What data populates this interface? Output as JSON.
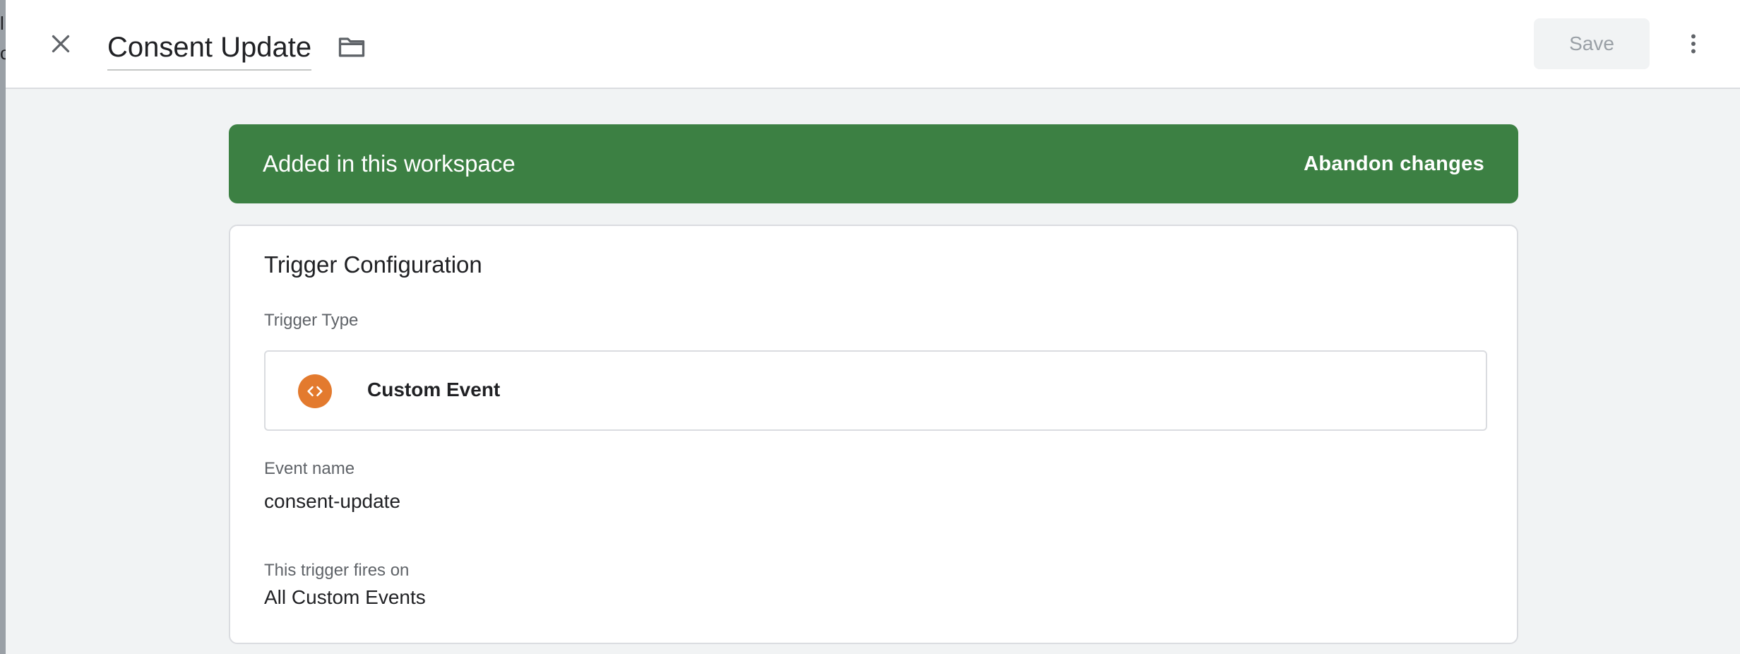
{
  "header": {
    "title": "Consent Update",
    "save_label": "Save"
  },
  "banner": {
    "text": "Added in this workspace",
    "action": "Abandon changes"
  },
  "card": {
    "title": "Trigger Configuration",
    "trigger_type_label": "Trigger Type",
    "trigger_type_value": "Custom Event",
    "event_name_label": "Event name",
    "event_name_value": "consent-update",
    "fires_on_label": "This trigger fires on",
    "fires_on_value": "All Custom Events"
  },
  "icons": {
    "close": "close-icon",
    "folder": "folder-icon",
    "more": "more-vert-icon",
    "trigger_type": "code-icon"
  },
  "colors": {
    "banner_green": "#3c8043",
    "trigger_icon_orange": "#e37a2e",
    "background": "#f1f3f4"
  }
}
